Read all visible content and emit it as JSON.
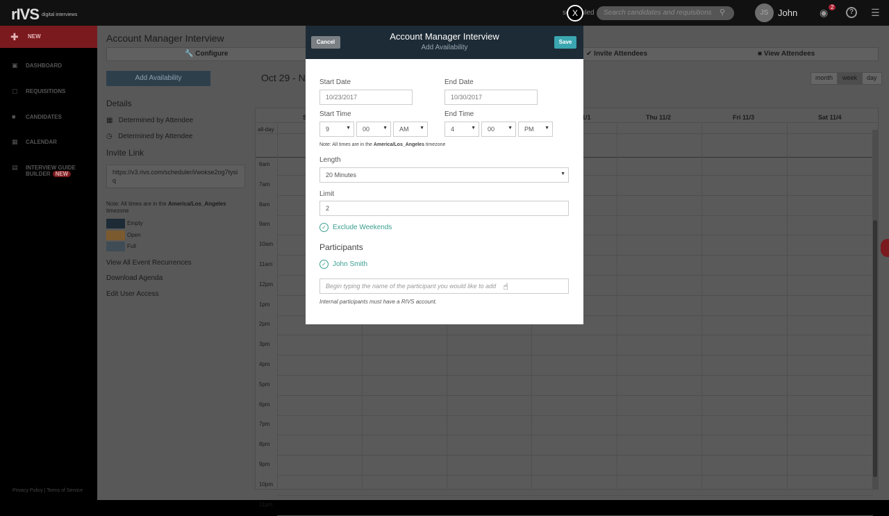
{
  "topbar": {
    "logo": "rIVS",
    "logo_sub": "digital interviews",
    "search_placeholder": "Search candidates and requisitions",
    "scheduled_text": "scheduled",
    "avatar_initials": "JS",
    "user_name": "John",
    "notification_count": "2",
    "help_label": "?",
    "close_label": "X"
  },
  "sidebar": {
    "new_label": "NEW",
    "items": [
      {
        "label": "DASHBOARD"
      },
      {
        "label": "REQUISITIONS"
      },
      {
        "label": "CANDIDATES"
      },
      {
        "label": "CALENDAR"
      },
      {
        "label": "INTERVIEW GUIDE",
        "label2": "BUILDER",
        "badge": "NEW"
      }
    ],
    "footer": "Privacy Policy | Terms of Service"
  },
  "main": {
    "title": "Account Manager Interview",
    "steps": [
      "Configure",
      "Invite Attendees",
      "View Attendees"
    ],
    "add_availability": "Add Availability",
    "calendar_title": "Oct 29 - N",
    "views": [
      "month",
      "week",
      "day"
    ],
    "details_heading": "Details",
    "detail_rows": [
      "Determined by Attendee",
      "Determined by Attendee"
    ],
    "invite_heading": "Invite Link",
    "invite_link": "https://v3.rivs.com/scheduler/i/wokse2og7tysiq",
    "note_prefix": "Note: All times are in the ",
    "note_tz": "America/Los_Angeles",
    "note_suffix": " timezone",
    "legend": [
      {
        "label": "Empty",
        "color": "#1d2b36"
      },
      {
        "label": "Open",
        "color": "#7a5a2e"
      },
      {
        "label": "Full",
        "color": "#3f4c55"
      }
    ],
    "links": [
      "View All Event Recurrences",
      "Download Agenda",
      "Edit User Access"
    ]
  },
  "calendar": {
    "allday_label": "all-day",
    "day_headers": [
      "S",
      "1/1",
      "Thu 11/2",
      "Fri 11/3",
      "Sat 11/4"
    ],
    "hours": [
      "6am",
      "7am",
      "8am",
      "9am",
      "10am",
      "11am",
      "12pm",
      "1pm",
      "2pm",
      "3pm",
      "4pm",
      "5pm",
      "6pm",
      "7pm",
      "8pm",
      "9pm",
      "10pm",
      "11pm"
    ]
  },
  "modal": {
    "title": "Account Manager Interview",
    "subtitle": "Add Availability",
    "cancel": "Cancel",
    "save": "Save",
    "start_date_label": "Start Date",
    "start_date": "10/23/2017",
    "end_date_label": "End Date",
    "end_date": "10/30/2017",
    "start_time_label": "Start Time",
    "start_hour": "9",
    "start_min": "00",
    "start_ampm": "AM",
    "end_time_label": "End Time",
    "end_hour": "4",
    "end_min": "00",
    "end_ampm": "PM",
    "tz_note_prefix": "Note: All times are in the ",
    "tz_note_tz": "America/Los_Angeles",
    "tz_note_suffix": " timezone",
    "length_label": "Length",
    "length_value": "20 Minutes",
    "limit_label": "Limit",
    "limit_value": "2",
    "exclude_weekends": "Exclude Weekends",
    "participants_heading": "Participants",
    "participant_name": "John Smith",
    "participant_placeholder": "Begin typing the name of the participant you would like to add",
    "help_note": "Internal participants must have a RIVS account."
  }
}
